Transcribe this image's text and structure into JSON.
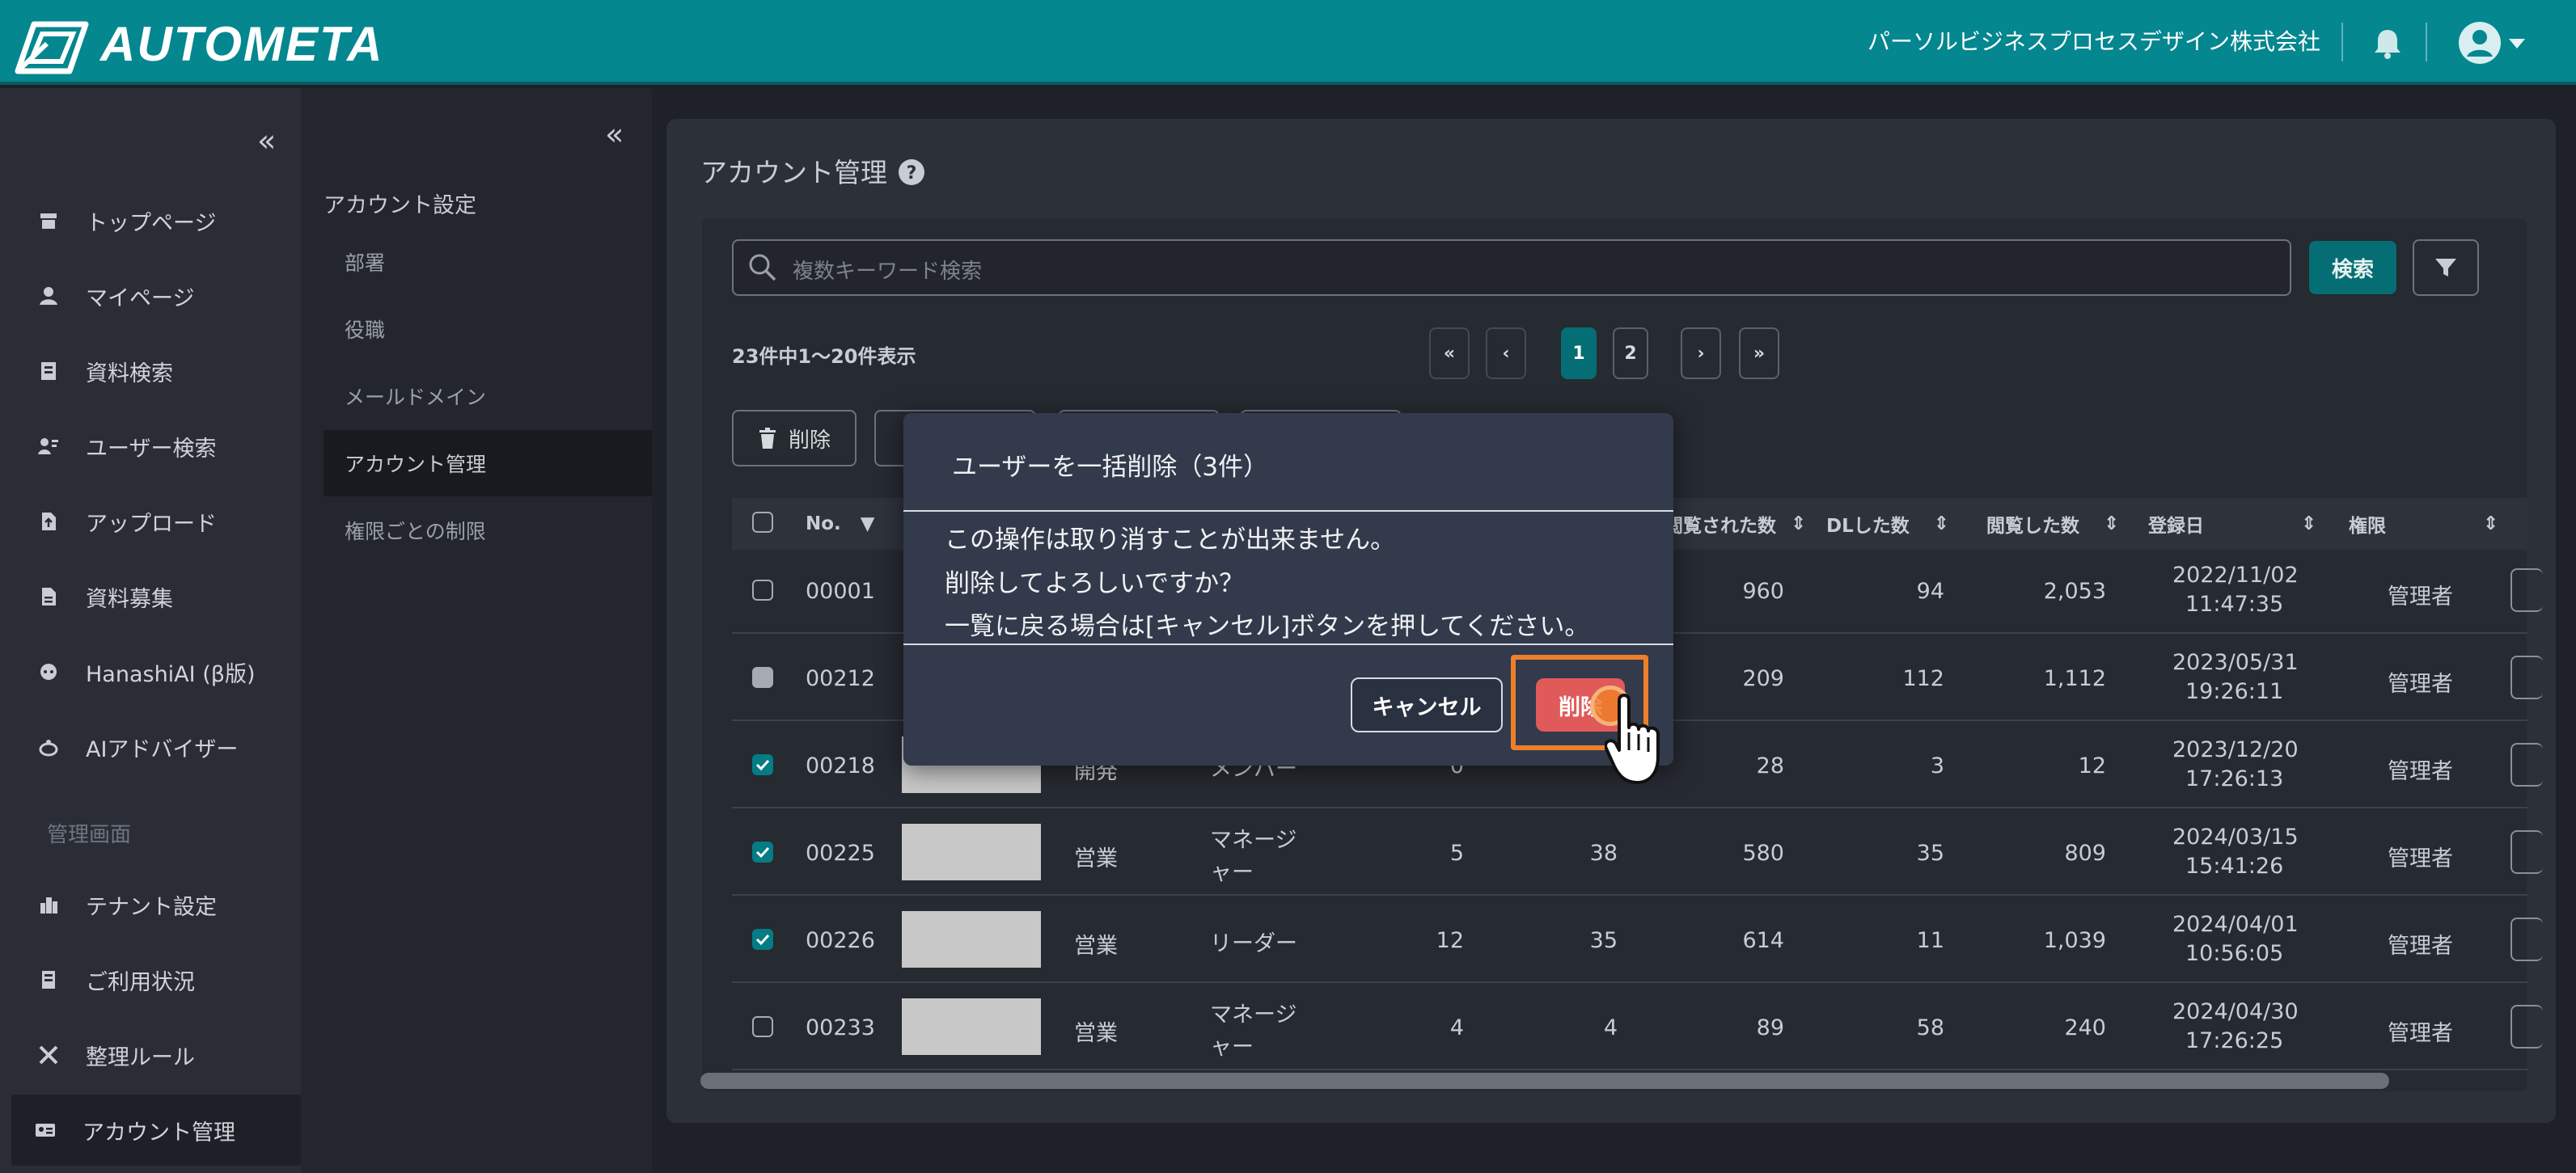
{
  "app": {
    "logo_text": "AUTOMETA",
    "company": "パーソルビジネスプロセスデザイン株式会社"
  },
  "sidebar": {
    "items": [
      {
        "label": "トップページ",
        "icon": "home-icon"
      },
      {
        "label": "マイページ",
        "icon": "user-icon"
      },
      {
        "label": "資料検索",
        "icon": "document-search-icon"
      },
      {
        "label": "ユーザー検索",
        "icon": "user-search-icon"
      },
      {
        "label": "アップロード",
        "icon": "upload-file-icon"
      },
      {
        "label": "資料募集",
        "icon": "file-icon"
      },
      {
        "label": "HanashiAI (β版)",
        "icon": "chat-ai-icon"
      },
      {
        "label": "AIアドバイザー",
        "icon": "advisor-icon"
      }
    ],
    "section_label": "管理画面",
    "admin_items": [
      {
        "label": "テナント設定",
        "icon": "building-icon"
      },
      {
        "label": "ご利用状況",
        "icon": "usage-icon"
      },
      {
        "label": "整理ルール",
        "icon": "tools-icon"
      },
      {
        "label": "アカウント管理",
        "icon": "id-card-icon"
      }
    ]
  },
  "subnav": {
    "heading": "アカウント設定",
    "items": [
      "部署",
      "役職",
      "メールドメイン",
      "アカウント管理",
      "権限ごとの制限"
    ]
  },
  "page": {
    "title": "アカウント管理"
  },
  "search": {
    "placeholder": "複数キーワード検索",
    "button": "検索"
  },
  "list": {
    "count_text": "23件中1〜20件表示",
    "pages": [
      "1",
      "2"
    ],
    "current_page": 1
  },
  "toolbar": {
    "delete_label": "削除"
  },
  "table": {
    "columns": [
      "No.",
      "閲覧された数",
      "DLした数",
      "閲覧した数",
      "登録日",
      "権限"
    ],
    "rows": [
      {
        "no": "00001",
        "checked": false,
        "dept": "",
        "role": "",
        "c1": "",
        "c2": "",
        "viewed_by": "960",
        "dl": "94",
        "viewed": "2,053",
        "date": "2022/11/02",
        "time": "11:47:35",
        "perm": "管理者"
      },
      {
        "no": "00212",
        "checked": "partial",
        "dept": "",
        "role": "",
        "c1": "",
        "c2": "",
        "viewed_by": "209",
        "dl": "112",
        "viewed": "1,112",
        "date": "2023/05/31",
        "time": "19:26:11",
        "perm": "管理者"
      },
      {
        "no": "00218",
        "checked": true,
        "dept": "開発",
        "role": "メンバー",
        "c1": "0",
        "c2": "",
        "viewed_by": "28",
        "dl": "3",
        "viewed": "12",
        "date": "2023/12/20",
        "time": "17:26:13",
        "perm": "管理者"
      },
      {
        "no": "00225",
        "checked": true,
        "dept": "営業",
        "role": "マネージ\nャー",
        "c1": "5",
        "c2": "38",
        "viewed_by": "580",
        "dl": "35",
        "viewed": "809",
        "date": "2024/03/15",
        "time": "15:41:26",
        "perm": "管理者"
      },
      {
        "no": "00226",
        "checked": true,
        "dept": "営業",
        "role": "リーダー",
        "c1": "12",
        "c2": "35",
        "viewed_by": "614",
        "dl": "11",
        "viewed": "1,039",
        "date": "2024/04/01",
        "time": "10:56:05",
        "perm": "管理者"
      },
      {
        "no": "00233",
        "checked": false,
        "dept": "営業",
        "role": "マネージ\nャー",
        "c1": "4",
        "c2": "4",
        "viewed_by": "89",
        "dl": "58",
        "viewed": "240",
        "date": "2024/04/30",
        "time": "17:26:25",
        "perm": "管理者"
      }
    ]
  },
  "modal": {
    "title": "ユーザーを一括削除（3件）",
    "lines": [
      "この操作は取り消すことが出来ません。",
      "削除してよろしいですか？",
      "一覧に戻る場合は[キャンセル]ボタンを押してください。"
    ],
    "cancel": "キャンセル",
    "delete": "削除"
  },
  "colors": {
    "header": "#04878f",
    "accent": "#056e74",
    "danger": "#e05a5a",
    "highlight": "#ee7f2a"
  }
}
